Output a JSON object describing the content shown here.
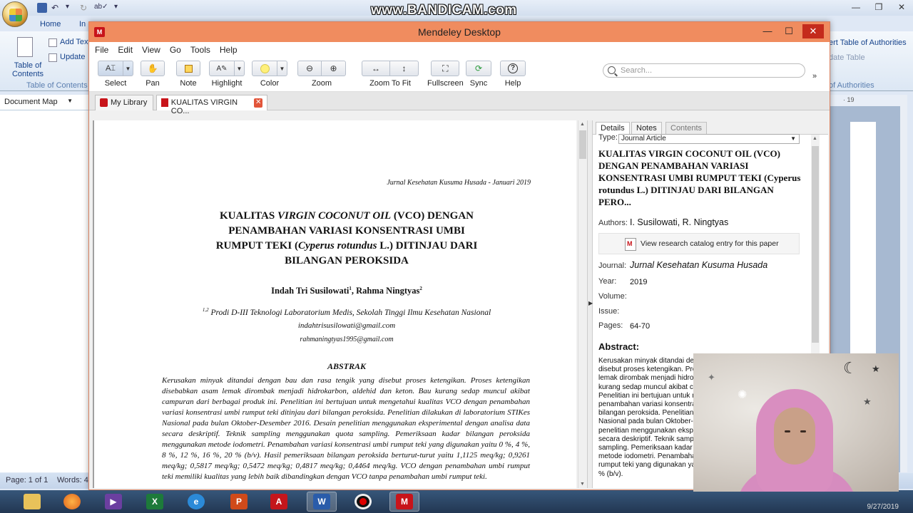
{
  "watermark": "www.BANDICAM.com",
  "word": {
    "tabs": {
      "home": "Home",
      "insert": "In"
    },
    "ribbon": {
      "toc": "Table of Contents",
      "add_text": "Add Text",
      "update": "Update",
      "group_toc": "Table of Contents",
      "insert_toa": "ert Table of Authorities",
      "update_table": "date Table",
      "group_toa": "of Authorities"
    },
    "document_map": "Document Map",
    "ruler": "· 19",
    "status": {
      "page": "Page: 1 of 1",
      "words": "Words: 4"
    }
  },
  "mendeley": {
    "title": "Mendeley Desktop",
    "menu": [
      "File",
      "Edit",
      "View",
      "Go",
      "Tools",
      "Help"
    ],
    "toolbar": {
      "select": "Select",
      "pan": "Pan",
      "note": "Note",
      "highlight": "Highlight",
      "color": "Color",
      "zoom": "Zoom",
      "zoom_to_fit": "Zoom To Fit",
      "fullscreen": "Fullscreen",
      "sync": "Sync",
      "help": "Help"
    },
    "search_placeholder": "Search...",
    "tabs": {
      "library": "My Library",
      "doc": "KUALITAS VIRGIN CO..."
    },
    "pdf": {
      "journal_header": "Jurnal Kesehatan Kusuma Husada - Januari 2019",
      "title_l1a": "KUALITAS ",
      "title_l1b": "VIRGIN COCONUT OIL",
      "title_l1c": " (VCO) DENGAN",
      "title_l2": "PENAMBAHAN VARIASI KONSENTRASI UMBI",
      "title_l3a": "RUMPUT TEKI (",
      "title_l3b": "Cyperus rotundus",
      "title_l3c": " L.) DITINJAU DARI",
      "title_l4": "BILANGAN PEROKSIDA",
      "authors_a": "Indah Tri Susilowati",
      "authors_sup1": "1",
      "authors_b": ", Rahma Ningtyas",
      "authors_sup2": "2",
      "affil_sup": "1,2",
      "affil": " Prodi D-III Teknologi Laboratorium Medis, Sekolah Tinggi Ilmu Kesehatan Nasional",
      "email1": "indahtrisusilowati@gmail.com",
      "email2": "rahmaningtyas1995@gmail.com",
      "abstract_head": "ABSTRAK",
      "abstract": "Kerusakan minyak ditandai dengan bau dan rasa tengik yang disebut proses ketengikan. Proses ketengikan disebabkan asam lemak dirombak menjadi hidrokarbon, aldehid dan keton. Bau kurang sedap muncul akibat campuran dari berbagai produk ini. Penelitian ini bertujuan untuk mengetahui kualitas VCO dengan penambahan variasi konsentrasi umbi rumput teki ditinjau dari bilangan peroksida. Penelitian dilakukan di laboratorium STIKes Nasional pada bulan Oktober-Desember 2016. Desain penelitian menggunakan eksperimental dengan analisa data secara deskriptif. Teknik sampling menggunakan quota sampling. Pemeriksaan kadar bilangan peroksida menggunakan metode iodometri. Penambahan variasi konsentrasi umbi rumput teki yang digunakan yaitu 0 %, 4 %, 8 %, 12 %, 16 %, 20 % (b/v). Hasil pemeriksaan bilangan peroksida berturut-turut yaitu 1,1125 meq/kg; 0,9261 meq/kg; 0,5817 meq/kg; 0,5472 meq/kg; 0,4817 meq/kg; 0,4464 meq/kg. VCO dengan penambahan umbi rumput teki memiliki kualitas yang lebih baik dibandingkan dengan VCO tanpa penambahan umbi rumput teki."
    },
    "details": {
      "tabs": [
        "Details",
        "Notes",
        "Contents"
      ],
      "type_label": "Type:",
      "type_value": "Journal Article",
      "title": "KUALITAS VIRGIN COCONUT OIL (VCO) DENGAN PENAMBAHAN VARIASI KONSENTRASI UMBI RUMPUT TEKI (Cyperus rotundus L.) DITINJAU DARI BILANGAN PERO...",
      "authors_label": "Authors:",
      "authors": "I. Susilowati, R. Ningtyas",
      "catalog": "View research catalog entry for this paper",
      "journal_label": "Journal:",
      "journal": "Jurnal Kesehatan Kusuma Husada",
      "year_label": "Year:",
      "year": "2019",
      "volume_label": "Volume:",
      "issue_label": "Issue:",
      "pages_label": "Pages:",
      "pages": "64-70",
      "abstract_label": "Abstract:",
      "abstract": "Kerusakan minyak ditandai dengan bau dan rasa tengik yang disebut proses ketengikan. Proses ketengikan disebabkan asam lemak dirombak menjadi hidrokarbon, aldehid dan keton. Bau kurang sedap muncul akibat campuran dari berbagai produk ini. Penelitian ini bertujuan untuk mengetahui kualitas VCO dengan penambahan variasi konsentrasi umbi rumput teki ditinjau dari bilangan peroksida. Penelitian dilakukan di laboratorium STIKes Nasional pada bulan Oktober-Desember 2016. Desain penelitian menggunakan eksperimental dengan analisa data secara deskriptif. Teknik sampling menggunakan quota sampling. Pemeriksaan kadar bilangan peroksida menggunakan metode iodometri. Penambahan variasi konsentrasi umbi rumput teki yang digunakan yaitu 0 %, 4 %, 8 %, 12 %, 16 %, 20 % (b/v)."
    }
  },
  "webcam_date": "9/27/2019",
  "colors": {
    "mendeley_title": "#f08c5f",
    "mendeley_red": "#c8141a",
    "taskbar": "#2b4566"
  }
}
